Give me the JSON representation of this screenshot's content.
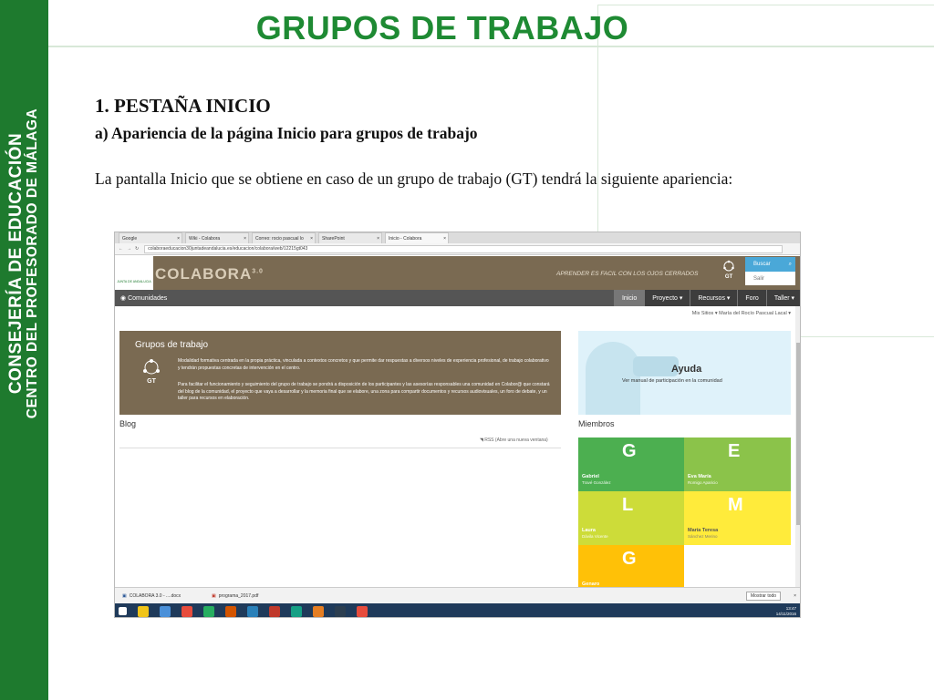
{
  "sidebar": {
    "line1": "CONSEJERÍA DE EDUCACIÓN",
    "line2": "CENTRO DEL PROFESORADO DE MÁLAGA"
  },
  "slide": {
    "title": "GRUPOS DE TRABAJO",
    "heading": "1. PESTAÑA INICIO",
    "subheading": "a) Apariencia de la página Inicio para grupos de trabajo",
    "paragraph": "La pantalla Inicio que se obtiene en caso de un grupo de trabajo (GT) tendrá la siguiente apariencia:"
  },
  "browser": {
    "tabs": [
      {
        "label": "Google"
      },
      {
        "label": "Wiki - Colabora"
      },
      {
        "label": "Correo: rocio pascual lo"
      },
      {
        "label": "SharePoint"
      },
      {
        "label": "Inicio - Colabora"
      }
    ],
    "url": "colaboraeducacion30juntadeandalucia.es/educacion/colabora/web/12215gt043"
  },
  "site": {
    "logo_small": "JUNTA DE ANDALUCIA",
    "brand": "COLABORA",
    "brand_version": "3.0",
    "slogan": "APRENDER ES FACIL CON LOS OJOS CERRADOS",
    "gt_badge": "GT",
    "search_label": "Buscar",
    "exit_label": "Salir",
    "nav": {
      "communities": "Comunidades",
      "items": [
        "Inicio",
        "Proyecto ▾",
        "Recursos ▾",
        "Foro",
        "Taller ▾"
      ]
    },
    "user_bar": "Mis Sitios ▾  María del Rocío Pascual Lacal ▾",
    "gt_panel": {
      "title": "Grupos de trabajo",
      "icon_label": "GT",
      "p1": "Modalidad formativa centrada en la propia práctica, vinculada a contextos concretos y que permite dar respuestas a diversos niveles de experiencia profesional, de trabajo colaborativo y tendrán propuestas concretas de intervención en el centro.",
      "p2": "Para facilitar el funcionamiento y seguimiento del grupo de trabajo se pondrá a disposición de los participantes y las asesorías responsables una comunidad en Colabor@ que constará del blog de la comunidad, el proyecto que vaya a desarrollar y la memoria final que se elabore, una zona para compartir documentos y recursos audiovisuales, un foro de debate, y un taller para recursos en elaboración."
    },
    "help": {
      "title": "Ayuda",
      "subtitle": "Ver manual de participación en la comunidad"
    },
    "blog": {
      "title": "Blog",
      "rss": "RSS (Abre una nueva ventana)"
    },
    "members": {
      "title": "Miembros",
      "items": [
        {
          "letter": "G",
          "name": "Gabriel",
          "surname": "Travé González",
          "color": "#4caf50"
        },
        {
          "letter": "E",
          "name": "Eva María",
          "surname": "Romigo Aparicio",
          "color": "#8bc34a"
        },
        {
          "letter": "L",
          "name": "Laura",
          "surname": "Dávila Vicente",
          "color": "#cddc39"
        },
        {
          "letter": "M",
          "name": "María Teresa",
          "surname": "Sánchez Merino",
          "color": "#ffeb3b"
        },
        {
          "letter": "G",
          "name": "Genaro",
          "surname": "",
          "color": "#ffc107"
        }
      ]
    }
  },
  "downloads": {
    "items": [
      "COLABORA 3.0 - ....docx",
      "programa_2017.pdf"
    ],
    "show_all": "Mostrar todo"
  },
  "taskbar": {
    "time": "13:47",
    "date": "14/11/2016",
    "colors": [
      "#f0c419",
      "#4a90d9",
      "#e74c3c",
      "#27ae60",
      "#d35400",
      "#2980b9",
      "#c0392b",
      "#16a085",
      "#e67e22",
      "#2c3e50",
      "#e74c3c"
    ]
  }
}
